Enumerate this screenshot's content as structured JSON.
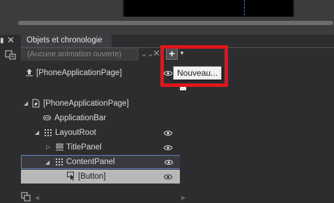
{
  "panel": {
    "tab_title": "Objets et chronologie",
    "animation_placeholder": "(Aucune animation ouverte)",
    "tooltip": "Nouveau..."
  },
  "scope": {
    "label": "[PhoneApplicationPage]"
  },
  "tree": {
    "items": [
      {
        "label": "[PhoneApplicationPage]",
        "expanded": true
      },
      {
        "label": "ApplicationBar"
      },
      {
        "label": "LayoutRoot",
        "expanded": true
      },
      {
        "label": "TitlePanel",
        "expanded": false
      },
      {
        "label": "ContentPanel",
        "expanded": true,
        "selected": true
      },
      {
        "label": "[Button]"
      }
    ]
  },
  "colors": {
    "highlight_border": "#e0161c",
    "selection_border": "#5e86c9"
  }
}
